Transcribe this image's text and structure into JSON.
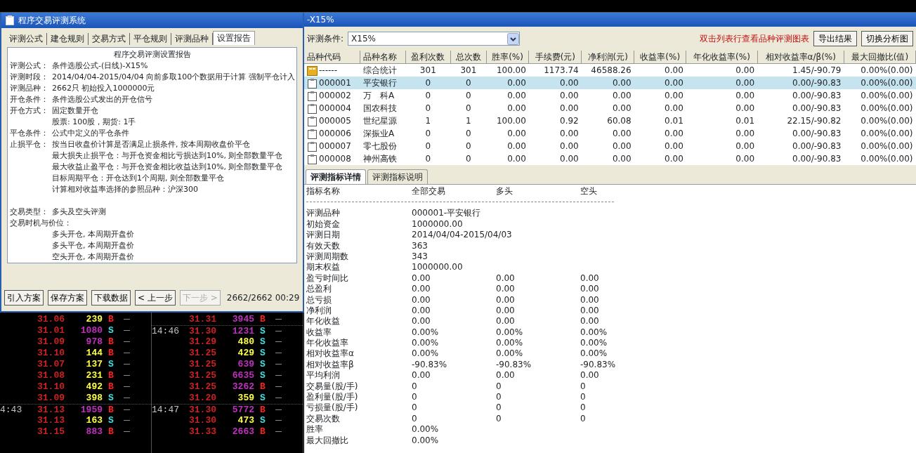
{
  "left_window": {
    "title": "程序交易评测系统",
    "tabs": [
      {
        "label": "评测公式",
        "selected": false
      },
      {
        "label": "建仓规则",
        "selected": false
      },
      {
        "label": "交易方式",
        "selected": false
      },
      {
        "label": "平仓规则",
        "selected": false
      },
      {
        "label": "评测品种",
        "selected": false
      },
      {
        "label": "设置报告",
        "selected": true
      }
    ],
    "report": {
      "title": "程序交易评测设置报告",
      "sections": [
        {
          "lines": [
            {
              "label": "评测公式：",
              "text": "条件选股公式-(日线)-X15%"
            },
            {
              "label": "评测时段：",
              "text": "2014/04/04-2015/04/04 向前多取100个数据用于计算 强制平仓计入"
            },
            {
              "label": "评测品种：",
              "text": "2662只 初始投入1000000元"
            },
            {
              "label": "开仓条件：",
              "text": "条件选股公式发出的开仓信号"
            },
            {
              "label": "开仓方式：",
              "text": "固定数量开仓"
            },
            {
              "text": "股票: 100股，期货: 1手"
            },
            {
              "label": "平仓条件：",
              "text": "公式中定义的平仓条件"
            },
            {
              "label": "止损平仓：",
              "text": "按当日收盘价计算是否满足止损条件, 按本周期收盘价平仓"
            },
            {
              "text": "最大损失止损平仓：与开仓资金相比亏损达到10%, 则全部数量平仓"
            },
            {
              "text": "最大收益止盈平仓：与开仓资金相比收益达到10%, 则全部数量平仓"
            },
            {
              "text": "目标周期平仓：开仓达到1个周期, 则全部数量平仓"
            },
            {
              "text": "计算相对收益率选择的参照品种：沪深300"
            }
          ]
        },
        {
          "lines": [
            {
              "label": "交易类型：",
              "text": "多头及空头评测"
            },
            {
              "label": "交易时机与价位："
            },
            {
              "text": "多头开仓, 本周期开盘价"
            },
            {
              "text": "多头平仓, 本周期开盘价"
            },
            {
              "text": "空头开仓, 本周期开盘价"
            }
          ]
        }
      ]
    },
    "buttons": [
      {
        "label": "引入方案",
        "disabled": false
      },
      {
        "label": "保存方案",
        "disabled": false
      },
      {
        "label": "下载数据",
        "disabled": false
      },
      {
        "label": "< 上一步",
        "disabled": false
      },
      {
        "label": "下一步 >",
        "disabled": true
      }
    ],
    "status": "2662/2662 00:29"
  },
  "ticker": [
    {
      "trades": [
        {
          "price": "31.06",
          "volume": "239",
          "color": "#ffff40",
          "side": "B",
          "kind": "buy",
          "divider_above": false
        },
        {
          "price": "31.01",
          "volume": "1080",
          "color": "#c030c0",
          "side": "S",
          "kind": "sell",
          "divider_above": false
        },
        {
          "price": "31.09",
          "volume": "978",
          "color": "#c030c0",
          "side": "B",
          "kind": "buy",
          "divider_above": false
        },
        {
          "price": "31.10",
          "volume": "144",
          "color": "#ffff40",
          "side": "B",
          "kind": "buy",
          "divider_above": false
        },
        {
          "price": "31.07",
          "volume": "137",
          "color": "#ffff40",
          "side": "S",
          "kind": "sell",
          "divider_above": false
        },
        {
          "price": "31.08",
          "volume": "231",
          "color": "#ffff40",
          "side": "B",
          "kind": "buy",
          "divider_above": false
        },
        {
          "price": "31.10",
          "volume": "492",
          "color": "#ffff40",
          "side": "B",
          "kind": "buy",
          "divider_above": false
        },
        {
          "price": "31.09",
          "volume": "398",
          "color": "#ffff40",
          "side": "S",
          "kind": "sell",
          "divider_above": false
        },
        {
          "time": "4:43",
          "price": "31.13",
          "volume": "1959",
          "color": "#c030c0",
          "side": "B",
          "kind": "buy",
          "divider_above": true
        },
        {
          "price": "31.13",
          "volume": "163",
          "color": "#ffff40",
          "side": "S",
          "kind": "sell",
          "divider_above": false
        },
        {
          "price": "31.15",
          "volume": "883",
          "color": "#c030c0",
          "side": "B",
          "kind": "buy",
          "divider_above": false
        }
      ]
    },
    {
      "trades": [
        {
          "price": "31.31",
          "volume": "3945",
          "color": "#c030c0",
          "side": "B",
          "kind": "buy",
          "divider_above": false
        },
        {
          "time": "14:46",
          "price": "31.30",
          "volume": "1231",
          "color": "#c030c0",
          "side": "S",
          "kind": "sell",
          "divider_above": true
        },
        {
          "price": "31.29",
          "volume": "480",
          "color": "#ffff40",
          "side": "S",
          "kind": "sell",
          "divider_above": false
        },
        {
          "price": "31.25",
          "volume": "429",
          "color": "#ffff40",
          "side": "S",
          "kind": "sell",
          "divider_above": false
        },
        {
          "price": "31.25",
          "volume": "639",
          "color": "#c030c0",
          "side": "S",
          "kind": "sell",
          "divider_above": false
        },
        {
          "price": "31.25",
          "volume": "6635",
          "color": "#c030c0",
          "side": "S",
          "kind": "sell",
          "divider_above": false
        },
        {
          "price": "31.25",
          "volume": "3262",
          "color": "#c030c0",
          "side": "B",
          "kind": "buy",
          "divider_above": false
        },
        {
          "price": "31.20",
          "volume": "359",
          "color": "#ffff40",
          "side": "S",
          "kind": "sell",
          "divider_above": false
        },
        {
          "time": "14:47",
          "price": "31.30",
          "volume": "5772",
          "color": "#c030c0",
          "side": "B",
          "kind": "buy",
          "divider_above": true
        },
        {
          "price": "31.30",
          "volume": "473",
          "color": "#ffff40",
          "side": "S",
          "kind": "sell",
          "divider_above": false
        },
        {
          "price": "31.33",
          "volume": "2663",
          "color": "#c030c0",
          "side": "B",
          "kind": "buy",
          "divider_above": false
        }
      ]
    }
  ],
  "right_window": {
    "title": "-X15%",
    "condition_label": "评测条件:",
    "condition_value": "X15%",
    "hint": "双击列表行查看品种评测图表",
    "buttons": [
      "导出结果",
      "切换分析图"
    ],
    "table": {
      "columns": [
        "品种代码",
        "品种名称",
        "盈利次数",
        "总次数",
        "胜率(%)",
        "手续费(元)",
        "净利润(元)",
        "收益率(%)",
        "年化收益率(%)",
        "相对收益率α/β(%)",
        "最大回撤比(值)"
      ],
      "rows": [
        {
          "kind": "summary",
          "selected": false,
          "cells": [
            "------",
            "综合统计",
            "301",
            "301",
            "100.00",
            "1173.74",
            "46588.26",
            "0.00",
            "0.00",
            "1.45/-90.79",
            "0.00%(0.00)"
          ]
        },
        {
          "kind": "stock",
          "selected": true,
          "cells": [
            "000001",
            "平安银行",
            "0",
            "0",
            "0.00",
            "0.00",
            "0.00",
            "0.00",
            "0.00",
            "0.00/-90.83",
            "0.00%(0.00)"
          ]
        },
        {
          "kind": "stock",
          "selected": false,
          "cells": [
            "000002",
            "万　科A",
            "0",
            "0",
            "0.00",
            "0.00",
            "0.00",
            "0.00",
            "0.00",
            "0.00/-90.83",
            "0.00%(0.00)"
          ]
        },
        {
          "kind": "stock",
          "selected": false,
          "cells": [
            "000004",
            "国农科技",
            "0",
            "0",
            "0.00",
            "0.00",
            "0.00",
            "0.00",
            "0.00",
            "0.00/-90.83",
            "0.00%(0.00)"
          ]
        },
        {
          "kind": "stock",
          "selected": false,
          "cells": [
            "000005",
            "世纪星源",
            "1",
            "1",
            "100.00",
            "0.92",
            "60.08",
            "0.01",
            "0.01",
            "22.15/-90.82",
            "0.00%(0.00)"
          ]
        },
        {
          "kind": "stock",
          "selected": false,
          "cells": [
            "000006",
            "深振业A",
            "0",
            "0",
            "0.00",
            "0.00",
            "0.00",
            "0.00",
            "0.00",
            "0.00/-90.83",
            "0.00%(0.00)"
          ]
        },
        {
          "kind": "stock",
          "selected": false,
          "cells": [
            "000007",
            "零七股份",
            "0",
            "0",
            "0.00",
            "0.00",
            "0.00",
            "0.00",
            "0.00",
            "0.00/-90.83",
            "0.00%(0.00)"
          ]
        },
        {
          "kind": "stock",
          "selected": false,
          "cells": [
            "000008",
            "神州高铁",
            "0",
            "0",
            "0.00",
            "0.00",
            "0.00",
            "0.00",
            "0.00",
            "0.00/-90.83",
            "0.00%(0.00)"
          ]
        }
      ]
    },
    "detail_tabs": [
      {
        "label": "评测指标详情",
        "selected": true
      },
      {
        "label": "评测指标说明",
        "selected": false
      }
    ],
    "detail": {
      "header": {
        "name": "指标名称",
        "values": [
          "全部交易",
          "多头",
          "空头"
        ]
      },
      "rows": [
        {
          "name": "评测品种",
          "values": [
            "000001-平安银行"
          ]
        },
        {
          "name": "初始资金",
          "values": [
            "1000000.00"
          ]
        },
        {
          "name": "评测日期",
          "values": [
            "2014/04/04-2015/04/03"
          ]
        },
        {
          "name": "有效天数",
          "values": [
            "363"
          ]
        },
        {
          "name": "评测周期数",
          "values": [
            "343"
          ]
        },
        {
          "name": "期末权益",
          "values": [
            "1000000.00"
          ]
        },
        {
          "name": "盈亏时间比",
          "values": [
            "0.00",
            "0.00",
            "0.00"
          ]
        },
        {
          "name": "总盈利",
          "values": [
            "0.00",
            "0.00",
            "0.00"
          ]
        },
        {
          "name": "总亏损",
          "values": [
            "0.00",
            "0.00",
            "0.00"
          ]
        },
        {
          "name": "净利润",
          "values": [
            "0.00",
            "0.00",
            "0.00"
          ]
        },
        {
          "name": "年化收益",
          "values": [
            "0.00",
            "0.00",
            "0.00"
          ]
        },
        {
          "name": "收益率",
          "values": [
            "0.00%",
            "0.00%",
            "0.00%"
          ]
        },
        {
          "name": "年化收益率",
          "values": [
            "0.00%",
            "0.00%",
            "0.00%"
          ]
        },
        {
          "name": "相对收益率α",
          "values": [
            "0.00%",
            "0.00%",
            "0.00%"
          ]
        },
        {
          "name": "相对收益率β",
          "values": [
            "-90.83%",
            "-90.83%",
            "-90.83%"
          ]
        },
        {
          "name": "平均利润",
          "values": [
            "0.00",
            "0.00",
            "0.00"
          ]
        },
        {
          "name": "交易量(股/手)",
          "values": [
            "0",
            "0",
            "0"
          ]
        },
        {
          "name": "盈利量(股/手)",
          "values": [
            "0",
            "0",
            "0"
          ]
        },
        {
          "name": "亏损量(股/手)",
          "values": [
            "0",
            "0",
            "0"
          ]
        },
        {
          "name": "交易次数",
          "values": [
            "0",
            "0",
            "0"
          ]
        },
        {
          "name": "胜率",
          "values": [
            "0.00%"
          ]
        },
        {
          "name": "最大回撤比",
          "values": [
            "0.00%"
          ]
        }
      ]
    }
  }
}
